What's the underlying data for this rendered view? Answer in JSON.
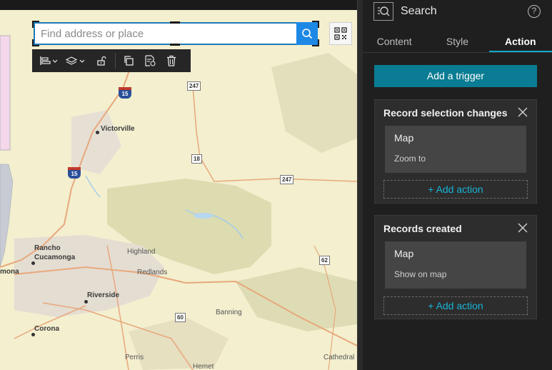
{
  "search": {
    "placeholder": "Find address or place"
  },
  "map": {
    "places": [
      {
        "name": "Victorville"
      },
      {
        "name": "Rancho"
      },
      {
        "name": "Cucamonga"
      },
      {
        "name": "Highland"
      },
      {
        "name": "Redlands"
      },
      {
        "name": "Riverside"
      },
      {
        "name": "Banning"
      },
      {
        "name": "Corona"
      },
      {
        "name": "Perris"
      },
      {
        "name": "Hemet"
      },
      {
        "name": "Cathedral"
      },
      {
        "name": "mona"
      }
    ],
    "routes": {
      "i15_north": "15",
      "i15_south": "15",
      "r247_north": "247",
      "r18": "18",
      "r247_south": "247",
      "r62": "62",
      "r60": "60"
    }
  },
  "panel": {
    "title": "Search",
    "tabs": [
      "Content",
      "Style",
      "Action"
    ],
    "active_tab": "Action",
    "add_trigger_label": "Add a trigger",
    "triggers": [
      {
        "title": "Record selection changes",
        "action": {
          "name": "Map",
          "desc": "Zoom to"
        },
        "add_action_label": "+ Add action"
      },
      {
        "title": "Records created",
        "action": {
          "name": "Map",
          "desc": "Show on map"
        },
        "add_action_label": "+ Add action"
      }
    ]
  },
  "colors": {
    "accent": "#11a8c7",
    "button": "#0a7c93",
    "map_background": "#f3efcf"
  }
}
